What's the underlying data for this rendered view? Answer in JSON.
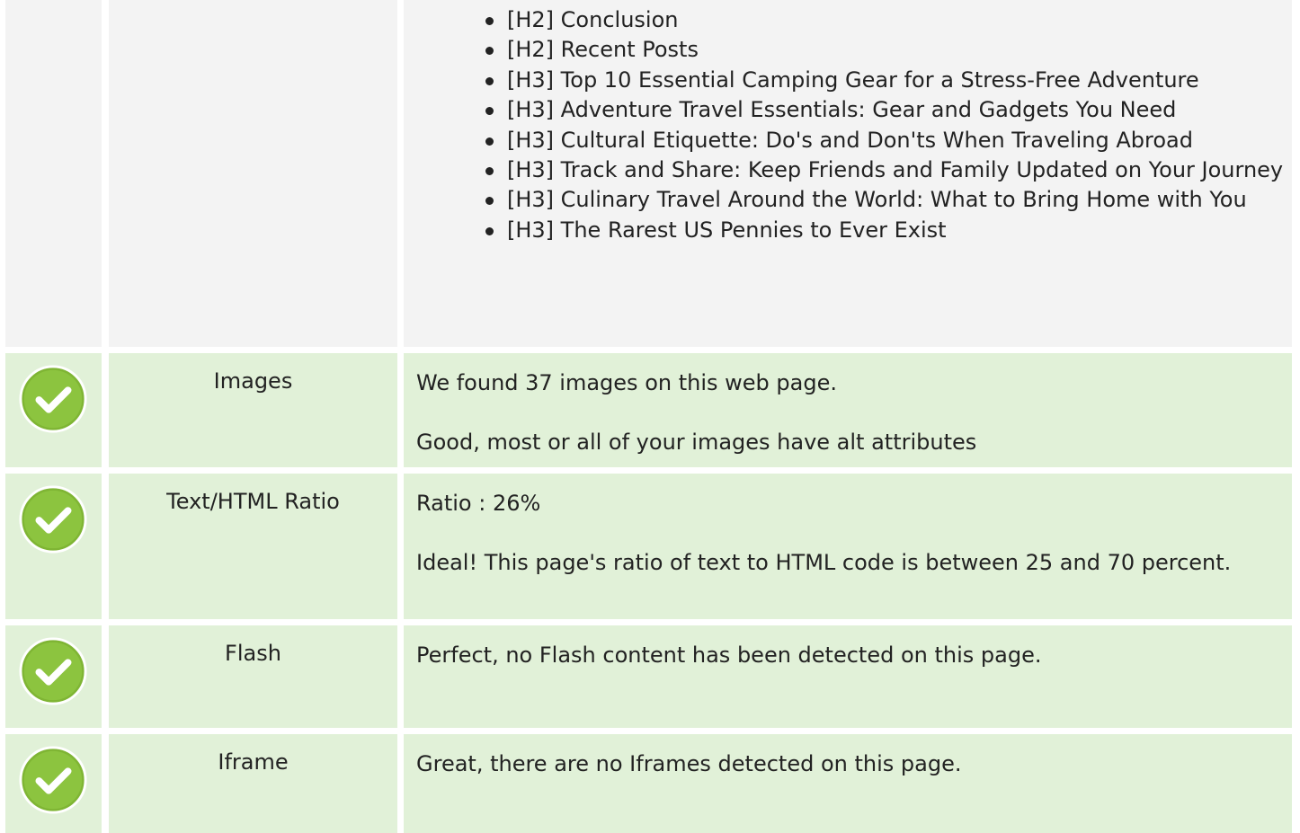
{
  "headings": {
    "items": [
      "[H2] Conclusion",
      "[H2] Recent Posts",
      "[H3] Top 10 Essential Camping Gear for a Stress-Free Adventure",
      "[H3] Adventure Travel Essentials: Gear and Gadgets You Need",
      "[H3] Cultural Etiquette: Do's and Don'ts When Traveling Abroad",
      "[H3] Track and Share: Keep Friends and Family Updated on Your Journey",
      "[H3] Culinary Travel Around the World: What to Bring Home with You",
      "[H3] The Rarest US Pennies to Ever Exist"
    ]
  },
  "checks": [
    {
      "label": "Images",
      "status_icon": "check-circle-icon",
      "messages": [
        "We found 37 images on this web page.",
        "Good, most or all of your images have alt attributes"
      ]
    },
    {
      "label": "Text/HTML Ratio",
      "status_icon": "check-circle-icon",
      "messages": [
        "Ratio : 26%",
        "Ideal! This page's ratio of text to HTML code is between 25 and 70 percent."
      ]
    },
    {
      "label": "Flash",
      "status_icon": "check-circle-icon",
      "messages": [
        "Perfect, no Flash content has been detected on this page."
      ]
    },
    {
      "label": "Iframe",
      "status_icon": "check-circle-icon",
      "messages": [
        "Great, there are no Iframes detected on this page."
      ]
    }
  ],
  "colors": {
    "row_pass_bg": "#e1f1d8",
    "row_neutral_bg": "#f3f3f3",
    "check_green": "#8cc43f"
  }
}
